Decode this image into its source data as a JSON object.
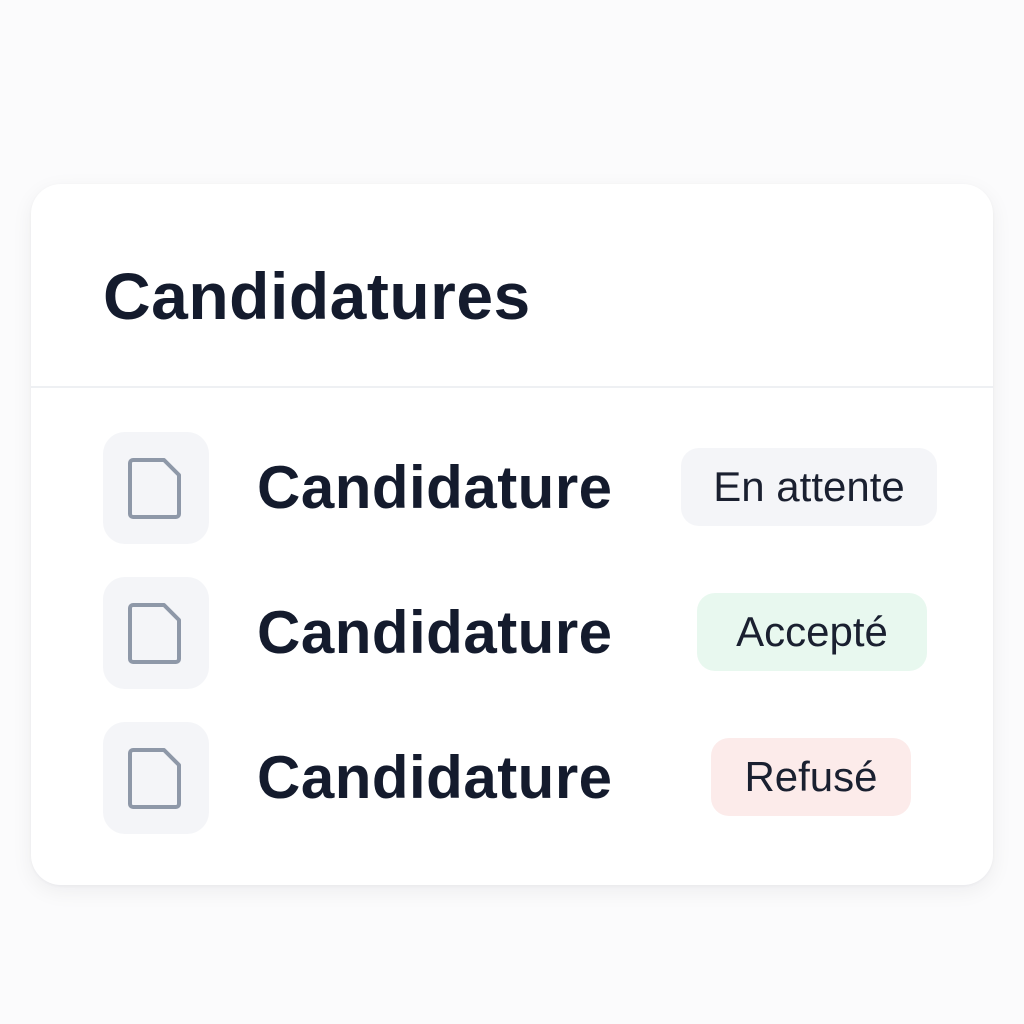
{
  "card": {
    "title": "Candidatures"
  },
  "applications": [
    {
      "label": "Candidature",
      "icon": "document-icon",
      "status": "En attente",
      "status_color": "#f4f5f8"
    },
    {
      "label": "Candidature",
      "icon": "document-icon",
      "status": "Accepté",
      "status_color": "#e8f8ef"
    },
    {
      "label": "Candidature",
      "icon": "document-icon",
      "status": "Refusé",
      "status_color": "#fcebea"
    }
  ],
  "colors": {
    "text": "#141b2d",
    "icon_stroke": "#8e98a8",
    "icon_background": "#f4f5f8"
  }
}
